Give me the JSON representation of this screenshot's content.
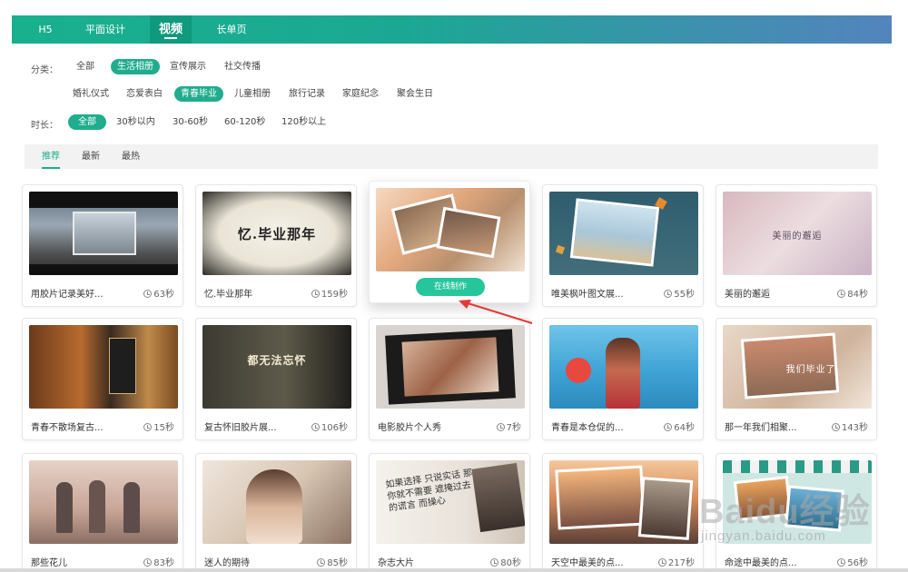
{
  "top_tabs": [
    {
      "label": "H5"
    },
    {
      "label": "平面设计"
    },
    {
      "label": "视频"
    },
    {
      "label": "长单页"
    }
  ],
  "filters": {
    "category_label": "分类：",
    "category_items": [
      {
        "label": "全部"
      },
      {
        "label": "生活相册"
      },
      {
        "label": "宣传展示"
      },
      {
        "label": "社交传播"
      }
    ],
    "sub_items": [
      {
        "label": "婚礼仪式"
      },
      {
        "label": "恋爱表白"
      },
      {
        "label": "青春毕业"
      },
      {
        "label": "儿童相册"
      },
      {
        "label": "旅行记录"
      },
      {
        "label": "家庭纪念"
      },
      {
        "label": "聚会生日"
      }
    ],
    "duration_label": "时长：",
    "duration_items": [
      {
        "label": "全部"
      },
      {
        "label": "30秒以内"
      },
      {
        "label": "30-60秒"
      },
      {
        "label": "60-120秒"
      },
      {
        "label": "120秒以上"
      }
    ]
  },
  "sort_tabs": [
    {
      "label": "推荐"
    },
    {
      "label": "最新"
    },
    {
      "label": "最热"
    }
  ],
  "make_button_label": "在线制作",
  "cards": [
    {
      "title": "用胶片记录美好...",
      "duration": "63秒",
      "thumb_text": ""
    },
    {
      "title": "忆.毕业那年",
      "duration": "159秒",
      "thumb_text": "忆.毕业那年"
    },
    {
      "title": "",
      "duration": "",
      "thumb_text": ""
    },
    {
      "title": "唯美枫叶图文展...",
      "duration": "55秒",
      "thumb_text": ""
    },
    {
      "title": "美丽的邂逅",
      "duration": "84秒",
      "thumb_text": "美丽的邂逅"
    },
    {
      "title": "青春不散场复古...",
      "duration": "15秒",
      "thumb_text": ""
    },
    {
      "title": "复古怀旧胶片展...",
      "duration": "106秒",
      "thumb_text": "都无法忘怀"
    },
    {
      "title": "电影胶片个人秀",
      "duration": "7秒",
      "thumb_text": ""
    },
    {
      "title": "青春是本仓促的...",
      "duration": "64秒",
      "thumb_text": ""
    },
    {
      "title": "那一年我们相聚...",
      "duration": "143秒",
      "thumb_text": "我们毕业了"
    },
    {
      "title": "那些花儿",
      "duration": "83秒",
      "thumb_text": ""
    },
    {
      "title": "迷人的期待",
      "duration": "85秒",
      "thumb_text": ""
    },
    {
      "title": "杂志大片",
      "duration": "80秒",
      "thumb_text": "如果选择 只说实话 那你就不需要 遮掩过去的谎言 而操心"
    },
    {
      "title": "天空中最美的点...",
      "duration": "217秒",
      "thumb_text": ""
    },
    {
      "title": "命途中最美的点...",
      "duration": "56秒",
      "thumb_text": ""
    }
  ],
  "watermark": {
    "main": "Baidu经验",
    "sub": "jingyan.baidu.com"
  },
  "colors": {
    "accent": "#1fad8d",
    "bar_start": "#19b08e",
    "bar_end": "#5384bd",
    "button": "#27c59b",
    "arrow": "#e53935"
  }
}
